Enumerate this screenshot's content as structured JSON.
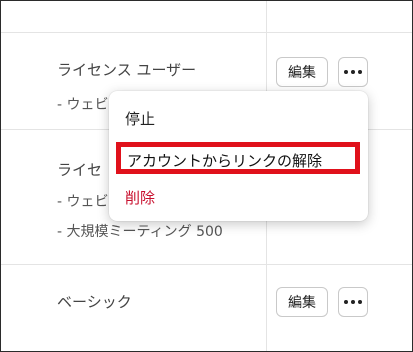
{
  "rows": [
    {
      "title": "ライセンス ユーザー",
      "features": [
        "- ウェビ"
      ],
      "edit_label": "編集"
    },
    {
      "title": "ライセ",
      "features": [
        "- ウェビ",
        "- 大規模ミーティング 500"
      ]
    },
    {
      "title": "ベーシック",
      "features": [],
      "edit_label": "編集"
    }
  ],
  "menu": {
    "items": [
      {
        "label": "停止"
      },
      {
        "label": "アカウントからリンクの解除"
      },
      {
        "label": "削除"
      }
    ],
    "danger_color": "#c8102e",
    "highlight_color": "#e0111b"
  }
}
